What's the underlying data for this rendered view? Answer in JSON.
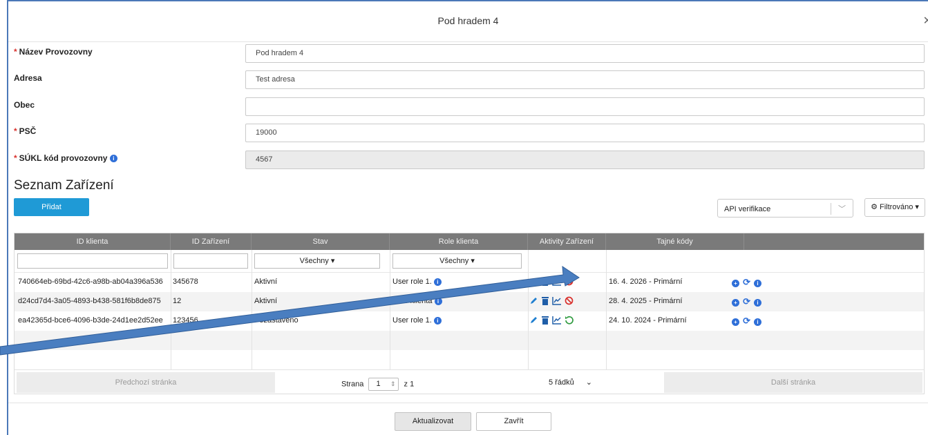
{
  "modal": {
    "title": "Pod hradem 4"
  },
  "form": {
    "fields": [
      {
        "label": "Název Provozovny",
        "required": true,
        "value": "Pod hradem 4"
      },
      {
        "label": "Adresa",
        "required": false,
        "value": "Test adresa"
      },
      {
        "label": "Obec",
        "required": false,
        "value": ""
      },
      {
        "label": "PSČ",
        "required": true,
        "value": "19000"
      },
      {
        "label": "SÚKL kód provozovny",
        "required": true,
        "value": "4567"
      }
    ]
  },
  "devices": {
    "title": "Seznam Zařízení",
    "add_label": "Přidat",
    "api_select_value": "API verifikace",
    "filter_label": "Filtrováno",
    "columns": [
      "ID klienta",
      "ID Zařízení",
      "Stav",
      "Role klienta",
      "Aktivity Zařízení",
      "Tajné kódy"
    ],
    "filter_all": "Všechny",
    "rows": [
      {
        "client_id": "740664eb-69bd-42c6-a98b-ab04a396a536",
        "device_id": "345678",
        "status": "Aktivní",
        "role": "User role 1.",
        "code": "16. 4. 2026 - Primární",
        "state_icon": "ban-icon"
      },
      {
        "client_id": "d24cd7d4-3a05-4893-b438-581f6b8de875",
        "device_id": "12",
        "status": "Aktivní",
        "role": "Role klienta",
        "code": "28. 4. 2025 - Primární",
        "state_icon": "ban-icon"
      },
      {
        "client_id": "ea42365d-bce6-4096-b3de-24d1ee2d52ee",
        "device_id": "123456",
        "status": "Pozastaveno",
        "role": "User role 1.",
        "code": "24. 10. 2024 - Primární",
        "state_icon": "restore-icon"
      }
    ],
    "pager": {
      "prev": "Předchozí stránka",
      "next": "Další stránka",
      "page_label": "Strana",
      "page": "1",
      "of_label": "z 1",
      "rows_per_page": "5 řádků"
    }
  },
  "footer": {
    "update": "Aktualizovat",
    "close": "Zavřít"
  },
  "colors": {
    "accent": "#1f9ad6",
    "danger": "#d9302c",
    "success": "#2e9a3e",
    "icon_blue": "#2f6fd8",
    "arrow": "#3f74b5"
  }
}
